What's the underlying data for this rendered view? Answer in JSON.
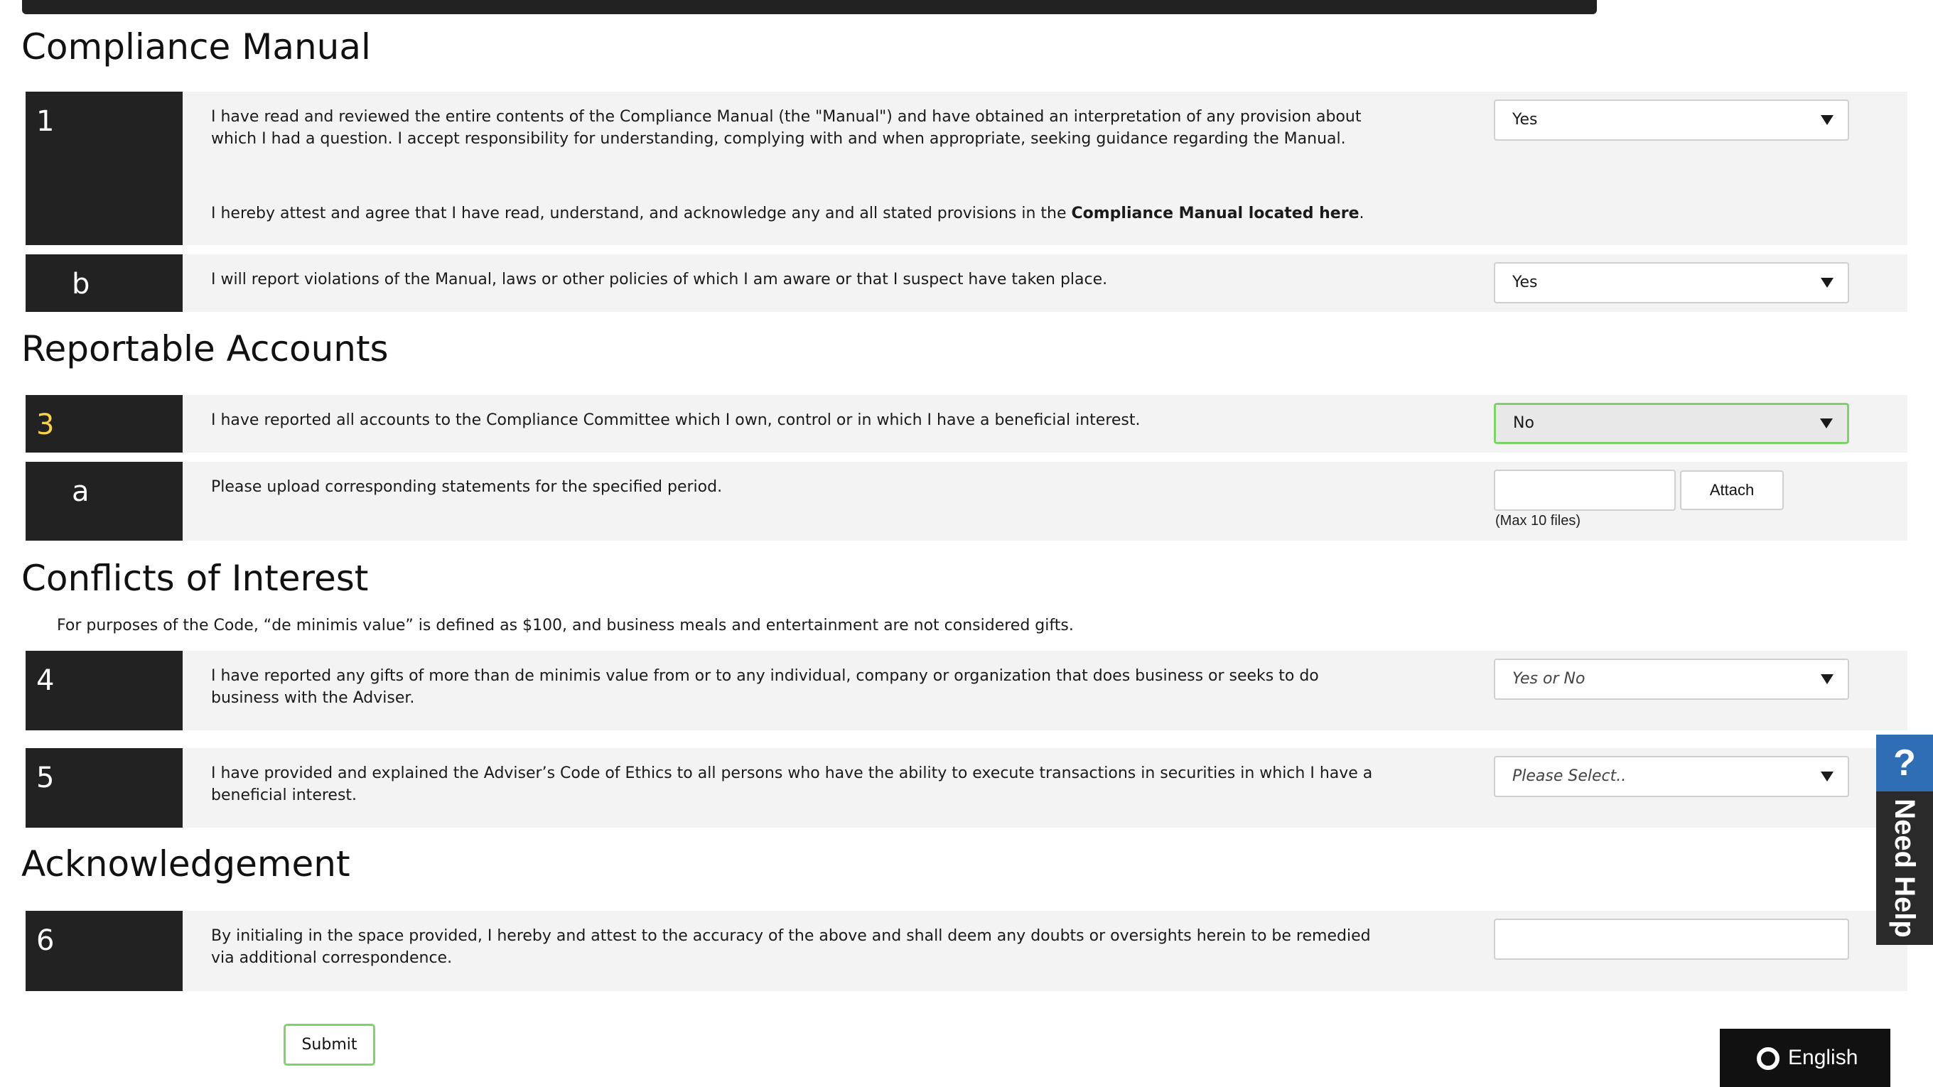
{
  "sections": {
    "compliance_manual": "Compliance Manual",
    "reportable_accounts": "Reportable Accounts",
    "conflicts_of_interest": "Conflicts of Interest",
    "acknowledgement": "Acknowledgement"
  },
  "questions": {
    "q1": {
      "number": "1",
      "text": "I have read and reviewed the entire contents of the Compliance Manual (the \"Manual\") and have obtained an interpretation of any provision about which I had a question. I accept responsibility for understanding, complying with and when appropriate, seeking guidance regarding the Manual.",
      "attest_prefix": "I hereby attest and agree that I have read, understand, and acknowledge any and all stated provisions in the ",
      "attest_link": "Compliance Manual located here",
      "attest_suffix": ".",
      "answer": "Yes"
    },
    "q1b": {
      "number": "b",
      "text": "I will report violations of the Manual, laws or other  policies of which I am aware or that I suspect have taken place.",
      "answer": "Yes"
    },
    "q3": {
      "number": "3",
      "text": "I have reported all accounts to the Compliance Committee which I own, control or in which I have a beneficial interest.",
      "answer": "No"
    },
    "q3a": {
      "number": "a",
      "text": "Please upload corresponding statements for the specified period.",
      "attach_label": "Attach",
      "max_files": "(Max 10 files)"
    },
    "conflicts_note": "For purposes of the Code, “de minimis value” is defined as $100, and business meals and entertainment are not considered gifts.",
    "q4": {
      "number": "4",
      "text": "I have reported any gifts of more than de minimis value from or to any individual, company or organization that does business or seeks to do business with the Adviser.",
      "answer_placeholder": "Yes or No"
    },
    "q5": {
      "number": "5",
      "text": "I have provided and explained the Adviser’s Code of Ethics to all persons who have the ability to execute transactions in securities in which I have a beneficial interest.",
      "answer_placeholder": "Please Select.."
    },
    "q6": {
      "number": "6",
      "text": "By initialing in the space provided, I hereby and attest to the accuracy of the above and shall deem any doubts or oversights herein to be remedied via additional correspondence.",
      "initials": ""
    }
  },
  "submit_label": "Submit",
  "help": {
    "icon": "?",
    "label": "Need Help"
  },
  "language": {
    "icon": "globe-icon",
    "label": "English"
  },
  "colors": {
    "number_cell_bg": "#222222",
    "row_bg": "#f3f3f3",
    "active_border": "#7ed36b",
    "highlight_number": "#f6d24a",
    "help_icon_bg": "#2f6db5"
  }
}
